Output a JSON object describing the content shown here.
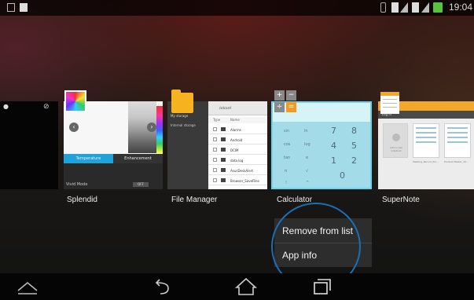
{
  "status_bar": {
    "clock": "19:04",
    "notifications": [
      "image-icon",
      "screenshot-icon"
    ],
    "system_icons": [
      "vibrate-icon",
      "sim-icon",
      "signal-icon",
      "sim-icon",
      "signal-icon",
      "battery-charging-icon"
    ]
  },
  "recent_apps": [
    {
      "name": "",
      "partial": true
    },
    {
      "name": "Splendid"
    },
    {
      "name": "File Manager"
    },
    {
      "name": "Calculator"
    },
    {
      "name": "SuperNote"
    }
  ],
  "splendid_preview": {
    "tabs": [
      "Temperature",
      "Enhancement"
    ],
    "mode_label": "Vivid Mode",
    "toggle": "OFF"
  },
  "files_preview": {
    "sidebar_title": "My storage",
    "sidebar_item": "Internal storage",
    "path": "/sdcard",
    "columns": [
      "Type",
      "Name"
    ],
    "rows": [
      "Alarms",
      "Android",
      "DCIM",
      "data.log",
      "AsusDeskAlert",
      "Browser_SaveFiles"
    ]
  },
  "calculator_preview": {
    "fn_keys": [
      "sin",
      "ln",
      "cos",
      "log",
      "tan",
      "e",
      "π",
      "√",
      "!",
      "^"
    ],
    "num_keys": [
      "7",
      "8",
      "4",
      "5",
      "1",
      "2",
      "0"
    ]
  },
  "supernote_preview": {
    "tab": "Log in",
    "add_label": "Add a new notebook",
    "pages": [
      "Meeting_Record_Pro...",
      "Product Master_10..."
    ]
  },
  "context_menu": {
    "items": [
      "Remove from list",
      "App info"
    ]
  },
  "nav_bar": {
    "buttons": [
      "hide-bar-icon",
      "back-icon",
      "home-icon",
      "recent-apps-icon"
    ]
  },
  "colors": {
    "highlight_ring": "#1b6fb4",
    "selected_card": "#6cd3ec",
    "menu_bg": "#2d2d2d"
  }
}
